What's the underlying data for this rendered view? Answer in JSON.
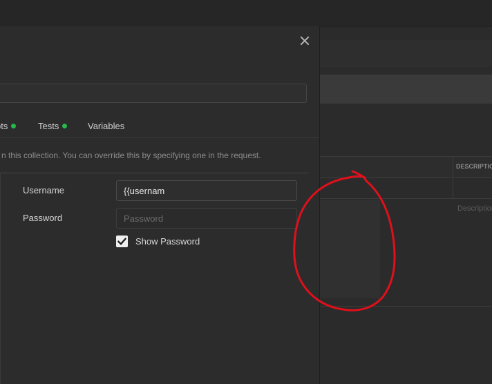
{
  "modal": {
    "tabs": [
      {
        "label": "pts",
        "has_dot": true
      },
      {
        "label": "Tests",
        "has_dot": true
      },
      {
        "label": "Variables",
        "has_dot": false
      }
    ],
    "auth_description": "n this collection. You can override this by specifying one in the request.",
    "username": {
      "label": "Username",
      "value": "{{usernam"
    },
    "password": {
      "label": "Password",
      "placeholder": "Password",
      "value": ""
    },
    "show_password": {
      "label": "Show Password",
      "checked": true
    }
  },
  "background": {
    "table_header_description": "DESCRIPTION",
    "table_cell_description_placeholder": "Description"
  },
  "colors": {
    "modal_bg": "#2c2c2c",
    "dot_green": "#26b84a",
    "annotation_red": "#e0101b"
  }
}
